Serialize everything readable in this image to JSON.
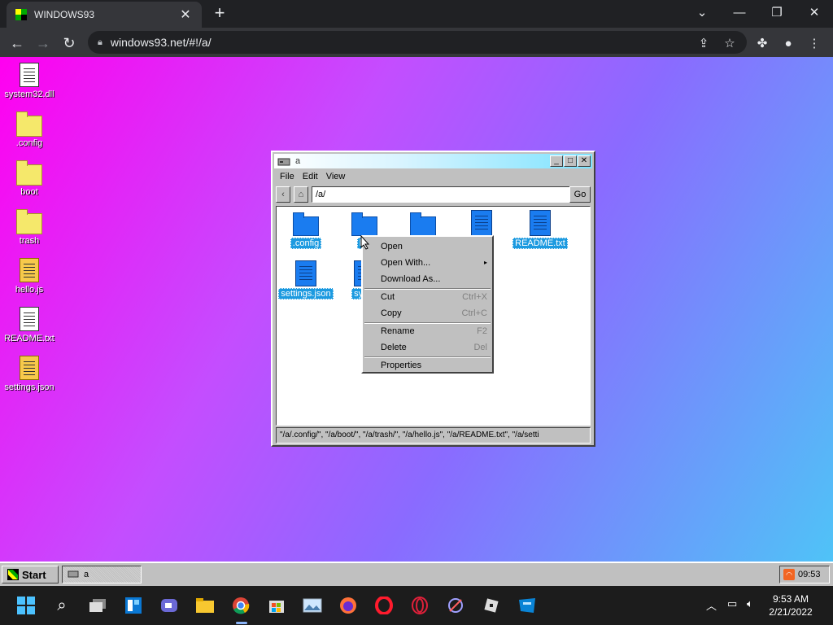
{
  "browser": {
    "tab_title": "WINDOWS93",
    "url": "windows93.net/#!/a/",
    "tab_close": "✕",
    "new_tab": "+",
    "back": "←",
    "forward": "→",
    "reload": "↻",
    "minimize": "—",
    "restore": "❐",
    "close": "✕",
    "more": "⋮"
  },
  "desktop": {
    "icons": [
      {
        "label": "system32.dll",
        "icon": "dll-file-icon"
      },
      {
        "label": ".config",
        "icon": "folder-icon"
      },
      {
        "label": "boot",
        "icon": "folder-icon"
      },
      {
        "label": "trash",
        "icon": "folder-icon"
      },
      {
        "label": "hello.js",
        "icon": "js-file-icon"
      },
      {
        "label": "README.txt",
        "icon": "text-file-icon"
      },
      {
        "label": "settings.json",
        "icon": "json-file-icon"
      }
    ]
  },
  "explorer": {
    "title": "a",
    "menu": [
      "File",
      "Edit",
      "View"
    ],
    "back_btn": "‹",
    "address": "/a/",
    "go_label": "Go",
    "files": [
      {
        "label": ".config",
        "type": "folder"
      },
      {
        "label": "bo",
        "type": "folder"
      },
      {
        "label": "",
        "type": "folder"
      },
      {
        "label": "",
        "type": "file"
      },
      {
        "label": "README.txt",
        "type": "file"
      },
      {
        "label": "settings.json",
        "type": "file"
      },
      {
        "label": "syste",
        "type": "file"
      }
    ],
    "status": "\"/a/.config/\", \"/a/boot/\", \"/a/trash/\", \"/a/hello.js\", \"/a/README.txt\", \"/a/setti"
  },
  "context_menu": {
    "open": "Open",
    "open_with": "Open With...",
    "download_as": "Download As...",
    "cut": "Cut",
    "cut_sc": "Ctrl+X",
    "copy": "Copy",
    "copy_sc": "Ctrl+C",
    "rename": "Rename",
    "rename_sc": "F2",
    "delete": "Delete",
    "delete_sc": "Del",
    "properties": "Properties"
  },
  "w93_taskbar": {
    "start": "Start",
    "task": "a",
    "time": "09:53"
  },
  "os_taskbar": {
    "time": "9:53 AM",
    "date": "2/21/2022"
  },
  "colors": {
    "desktop_gradient_start": "#ff00f0",
    "desktop_gradient_end": "#4fc3f7",
    "selection": "#1c9ae0"
  }
}
